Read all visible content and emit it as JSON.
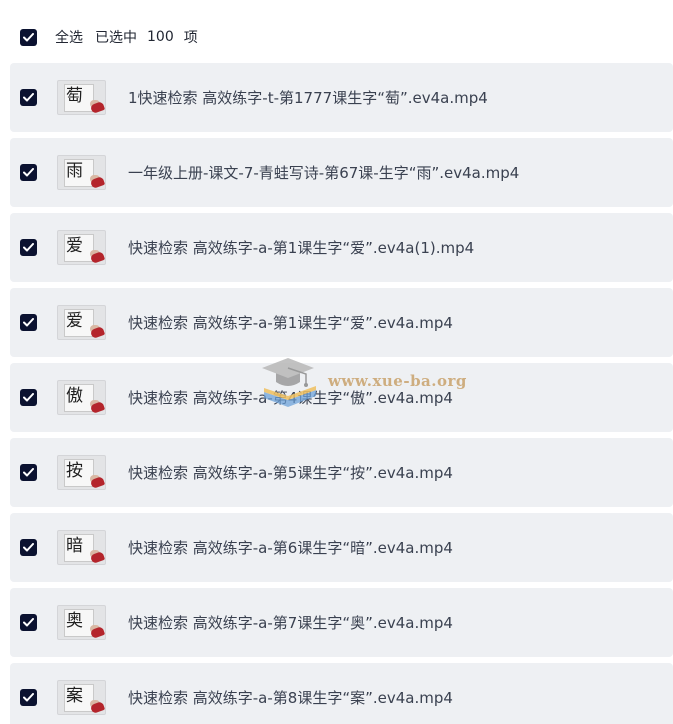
{
  "header": {
    "select_all_label": "全选",
    "selected_prefix": "已选中",
    "selected_count": "100",
    "selected_suffix": "项",
    "all_checked": true
  },
  "files": [
    {
      "name": "1快速检索 高效练字-t-第1777课生字“萄”.ev4a.mp4",
      "thumb_glyph": "萄",
      "checked": true
    },
    {
      "name": "一年级上册-课文-7-青蛙写诗-第67课-生字“雨”.ev4a.mp4",
      "thumb_glyph": "雨",
      "checked": true
    },
    {
      "name": "快速检索 高效练字-a-第1课生字“爱”.ev4a(1).mp4",
      "thumb_glyph": "爱",
      "checked": true
    },
    {
      "name": "快速检索 高效练字-a-第1课生字“爱”.ev4a.mp4",
      "thumb_glyph": "爱",
      "checked": true
    },
    {
      "name": "快速检索 高效练字-a-第4课生字“傲”.ev4a.mp4",
      "thumb_glyph": "傲",
      "checked": true
    },
    {
      "name": "快速检索 高效练字-a-第5课生字“按”.ev4a.mp4",
      "thumb_glyph": "按",
      "checked": true
    },
    {
      "name": "快速检索 高效练字-a-第6课生字“暗”.ev4a.mp4",
      "thumb_glyph": "暗",
      "checked": true
    },
    {
      "name": "快速检索 高效练字-a-第7课生字“奥”.ev4a.mp4",
      "thumb_glyph": "奥",
      "checked": true
    },
    {
      "name": "快速检索 高效练字-a-第8课生字“案”.ev4a.mp4",
      "thumb_glyph": "案",
      "checked": true
    }
  ],
  "watermark": {
    "text": "www.xue-ba.org",
    "icon": "graduation-cap-book-icon"
  },
  "colors": {
    "checkbox": "#0b1230",
    "row_background": "#eef0f3",
    "filename_text": "#3a4150",
    "watermark_text": "#c9a26b"
  }
}
